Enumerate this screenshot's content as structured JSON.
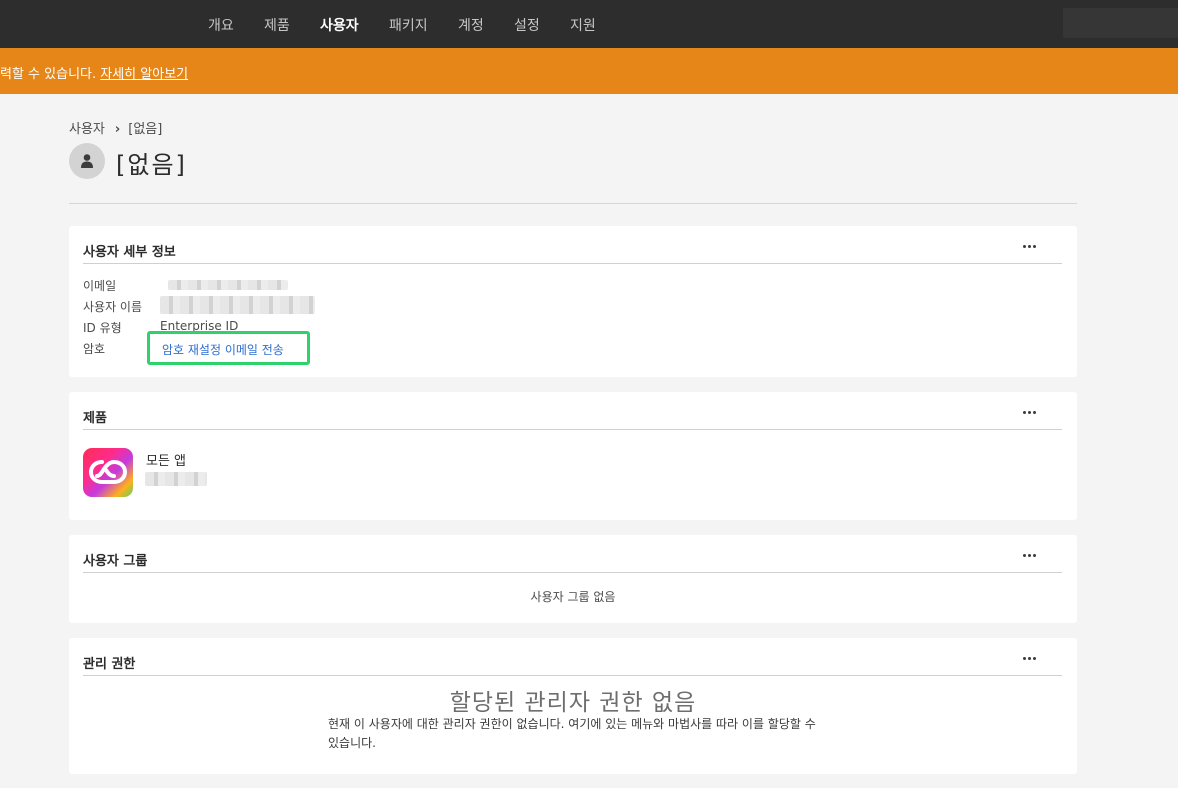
{
  "nav": {
    "tabs": [
      {
        "label": "개요"
      },
      {
        "label": "제품"
      },
      {
        "label": "사용자"
      },
      {
        "label": "패키지"
      },
      {
        "label": "계정"
      },
      {
        "label": "설정"
      },
      {
        "label": "지원"
      }
    ],
    "active_tab": "사용자"
  },
  "banner": {
    "text": "력할 수 있습니다.",
    "link_label": "자세히 알아보기",
    "color": "#e68619"
  },
  "breadcrumb": {
    "root": "사용자",
    "current": "[없음]"
  },
  "page": {
    "title": "[없음]",
    "avatar_icon": "user-icon"
  },
  "user_details": {
    "title": "사용자 세부 정보",
    "rows": [
      {
        "label": "이메일"
      },
      {
        "label": "사용자 이름"
      },
      {
        "label": "ID 유형",
        "value": "Enterprise ID"
      },
      {
        "label": "암호",
        "link": "암호 재설정 이메일 전송"
      }
    ]
  },
  "products": {
    "title": "제품",
    "items": [
      {
        "name": "모든 앱",
        "icon": "creative-cloud-icon"
      }
    ]
  },
  "user_groups": {
    "title": "사용자 그룹",
    "empty_text": "사용자 그룹 없음"
  },
  "admin_rights": {
    "title": "관리 권한",
    "empty_title": "할당된 관리자 권한 없음",
    "empty_desc": "현재 이 사용자에 대한 관리자 권한이 없습니다. 여기에 있는 메뉴와 마법사를 따라 이를 할당할 수 있습니다."
  },
  "colors": {
    "nav_bg": "#2d2d2d",
    "banner_bg": "#e68619",
    "link": "#2d6fcf",
    "highlight": "#2ed26b"
  }
}
